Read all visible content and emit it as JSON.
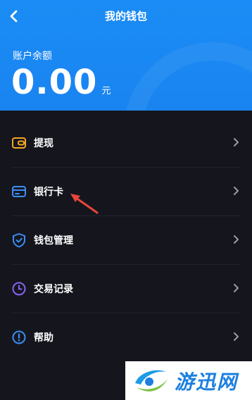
{
  "header": {
    "title": "我的钱包",
    "balance_label": "账户余额",
    "balance_amount": "0.00",
    "balance_unit": "元",
    "background_color": "#1b8cf5"
  },
  "menu": {
    "items": [
      {
        "label": "提现",
        "icon": "wallet-icon",
        "color": "#f5a623"
      },
      {
        "label": "银行卡",
        "icon": "credit-card-icon",
        "color": "#3a8ef6"
      },
      {
        "label": "钱包管理",
        "icon": "shield-check-icon",
        "color": "#3a8ef6"
      },
      {
        "label": "交易记录",
        "icon": "clock-icon",
        "color": "#8a63f0"
      },
      {
        "label": "帮助",
        "icon": "info-icon",
        "color": "#3a8ef6"
      }
    ]
  },
  "annotation": {
    "icon": "red-arrow-icon",
    "color": "#e8453c"
  },
  "watermark": {
    "text": "游迅网",
    "icon": "watermark-logo"
  }
}
